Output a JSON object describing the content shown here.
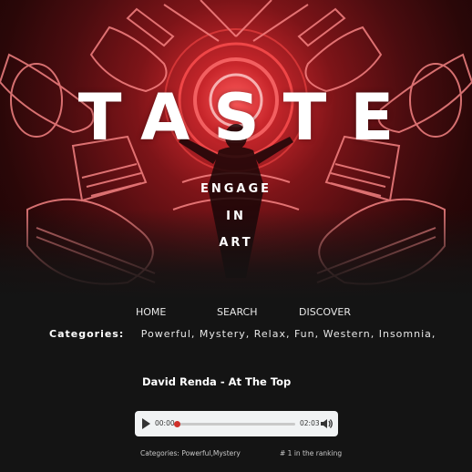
{
  "hero": {
    "title": "TASTE",
    "tagline": [
      "ENGAGE",
      "IN",
      "ART"
    ]
  },
  "nav": {
    "home": "HOME",
    "search": "SEARCH",
    "discover": "DISCOVER"
  },
  "categories": {
    "label": "Categories:",
    "list": "Powerful, Mystery, Relax, Fun, Western, Insomnia,"
  },
  "track": {
    "title": "David Renda - At The Top",
    "current_time": "00:00",
    "duration": "02:03",
    "progress": 0,
    "categories_meta": "Categories: Powerful,Mystery",
    "ranking": "# 1 in the ranking"
  },
  "colors": {
    "accent": "#c0392b",
    "neon": "#ff4b4b",
    "background": "#141414"
  },
  "icons": {
    "play": "play-icon",
    "volume": "volume-icon"
  }
}
